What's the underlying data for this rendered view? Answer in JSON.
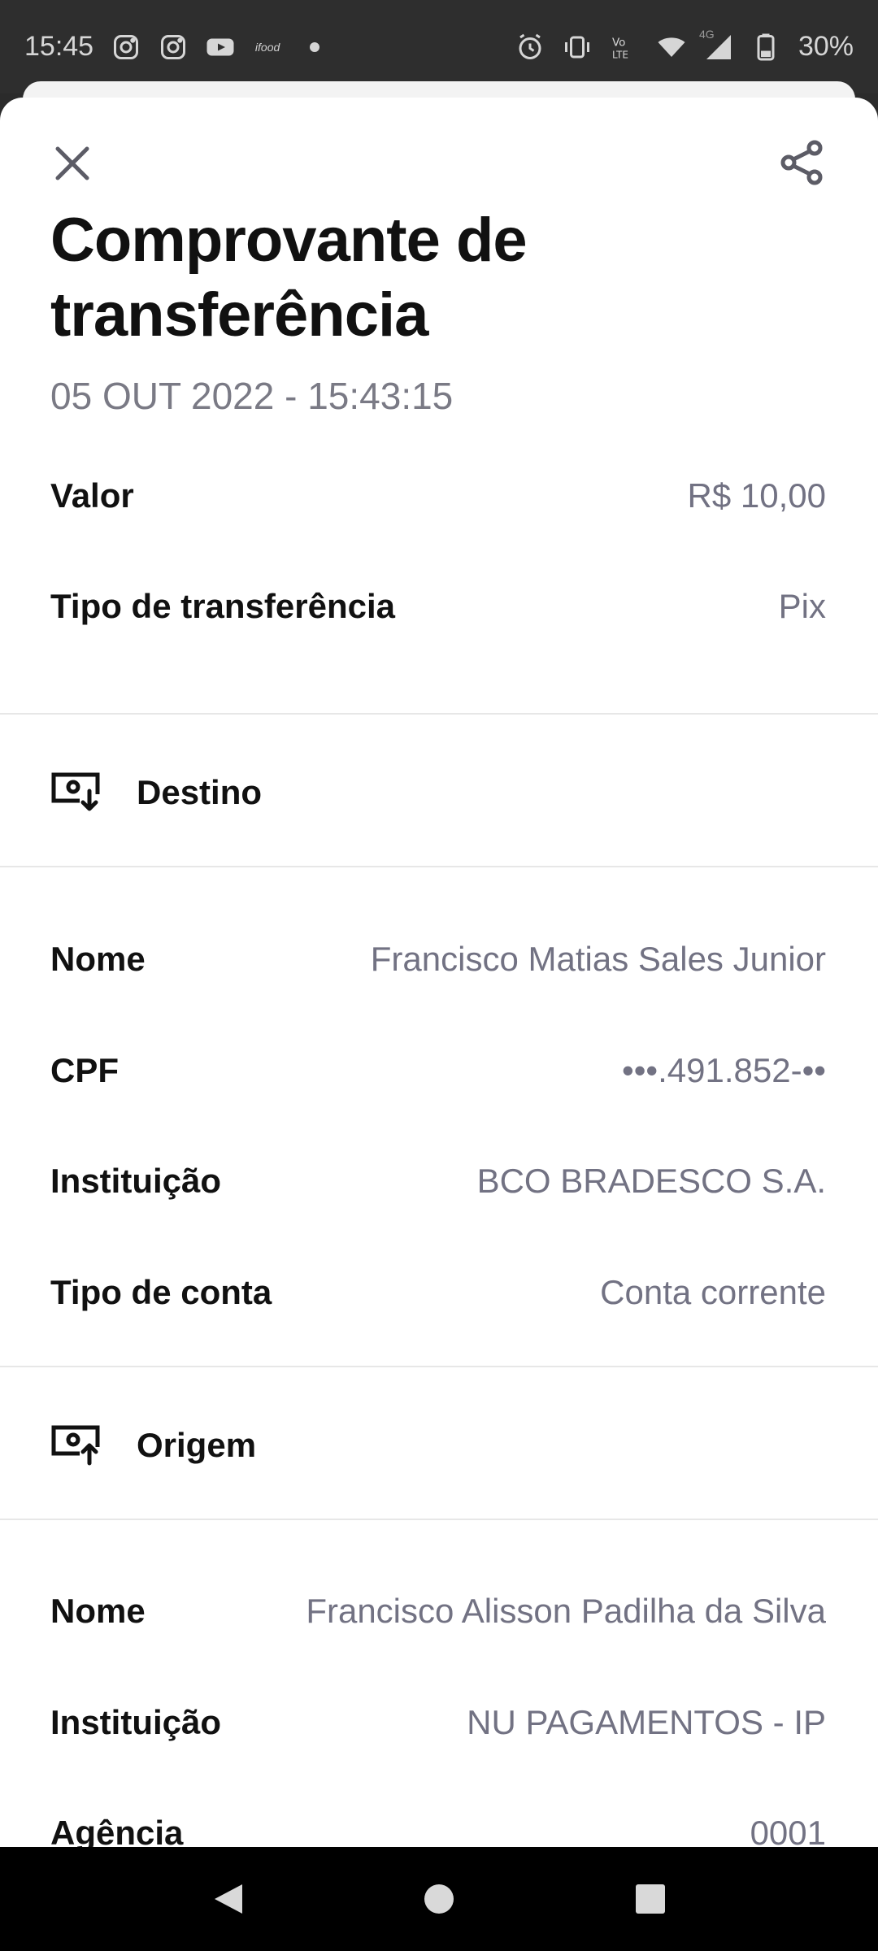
{
  "status_bar": {
    "time": "15:45",
    "battery": "30%",
    "network_label": "4G",
    "ifood_label": "ifood",
    "icons": [
      "instagram-icon",
      "instagram-icon",
      "youtube-icon",
      "ifood-icon",
      "dot-icon",
      "alarm-icon",
      "vibrate-icon",
      "volte-icon",
      "wifi-icon",
      "signal-icon",
      "battery-icon"
    ]
  },
  "header": {
    "title": "Comprovante de transferência",
    "datetime": "05 OUT 2022 - 15:43:15",
    "close_icon": "close-icon",
    "share_icon": "share-icon"
  },
  "summary": [
    {
      "label": "Valor",
      "value": "R$ 10,00"
    },
    {
      "label": "Tipo de transferência",
      "value": "Pix"
    }
  ],
  "destino": {
    "title": "Destino",
    "icon": "money-in-icon",
    "rows": [
      {
        "label": "Nome",
        "value": "Francisco Matias Sales Junior"
      },
      {
        "label": "CPF",
        "value": "•••.491.852-••"
      },
      {
        "label": "Instituição",
        "value": "BCO BRADESCO S.A."
      },
      {
        "label": "Tipo de conta",
        "value": "Conta corrente"
      }
    ]
  },
  "origem": {
    "title": "Origem",
    "icon": "money-out-icon",
    "rows": [
      {
        "label": "Nome",
        "value": "Francisco Alisson Padilha da Silva"
      },
      {
        "label": "Instituição",
        "value": "NU PAGAMENTOS - IP"
      },
      {
        "label": "Agência",
        "value": "0001"
      }
    ]
  },
  "nav": {
    "icons": [
      "back-icon",
      "home-icon",
      "recents-icon"
    ]
  },
  "colors": {
    "text_primary": "#111111",
    "text_secondary": "#727283",
    "divider": "#e7e7e7",
    "background": "#ffffff"
  }
}
